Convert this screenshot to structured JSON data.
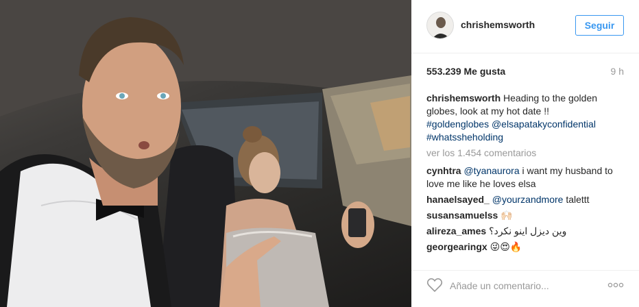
{
  "post": {
    "username": "chrishemsworth",
    "follow_label": "Seguir",
    "likes": "553.239 Me gusta",
    "time": "9 h",
    "caption": {
      "user": "chrishemsworth",
      "text": "Heading to the golden globes, look at my hot date !!",
      "tags": "#goldenglobes @elsapatakyconfidential",
      "tag_line2": "#whatssheholding"
    },
    "view_all": "ver los 1.454 comentarios",
    "comments": [
      {
        "user": "cynhtra",
        "mention": "@tyanaurora",
        "text": "i want my husband to love me like he loves elsa"
      },
      {
        "user": "hanaelsayed_",
        "mention": "@yourzandmore",
        "text": "talettt"
      },
      {
        "user": "susansamuelss",
        "mention": "",
        "text": "🙌🏻"
      },
      {
        "user": "alireza_ames",
        "mention": "",
        "text": "وین دیزل اینو نکرد؟"
      },
      {
        "user": "georgearingx",
        "mention": "",
        "text": "😜😍🔥"
      }
    ],
    "add_comment_placeholder": "Añade un comentario...",
    "icons": {
      "like": "heart-icon",
      "more": "more-options-icon"
    },
    "colors": {
      "link": "#003569",
      "button": "#3897f0",
      "muted": "#999999",
      "text": "#262626"
    }
  }
}
